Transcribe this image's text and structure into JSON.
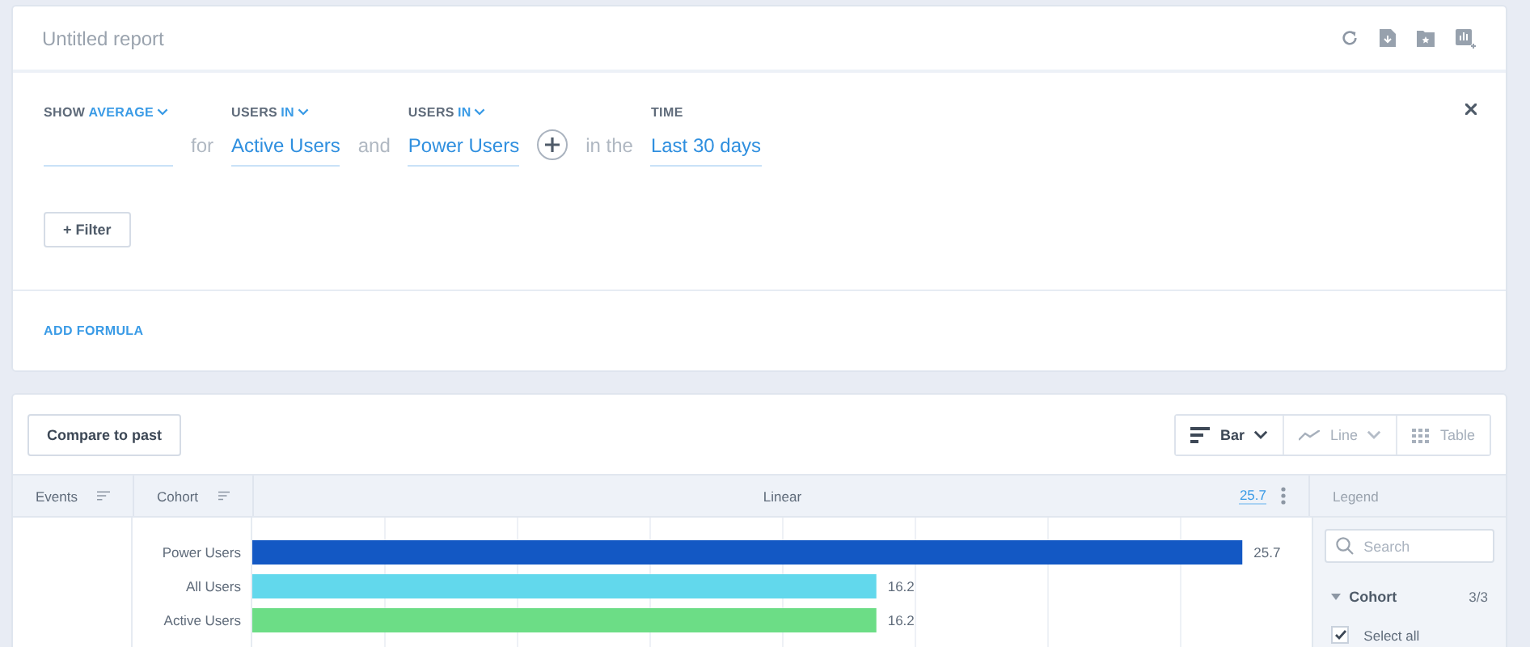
{
  "header": {
    "title": "Untitled report"
  },
  "query": {
    "segments": [
      {
        "kind": "metric",
        "label": "SHOW",
        "option": "AVERAGE"
      },
      {
        "kind": "word",
        "text": "for"
      },
      {
        "kind": "select",
        "label": "USERS",
        "option": "IN",
        "value": "Active Users"
      },
      {
        "kind": "word",
        "text": "and"
      },
      {
        "kind": "select",
        "label": "USERS",
        "option": "IN",
        "value": "Power Users"
      },
      {
        "kind": "add"
      },
      {
        "kind": "word",
        "text": "in the"
      },
      {
        "kind": "select",
        "label": "TIME",
        "value": "Last 30 days"
      }
    ],
    "filter_button": "+ Filter",
    "formula_link": "ADD FORMULA"
  },
  "toolbar": {
    "compare_button": "Compare to past",
    "views": [
      {
        "kind": "bar",
        "label": "Bar",
        "selected": true
      },
      {
        "kind": "line",
        "label": "Line",
        "selected": false
      },
      {
        "kind": "table",
        "label": "Table",
        "selected": false
      }
    ]
  },
  "table": {
    "columns": [
      "Events",
      "Cohort"
    ],
    "chart_heading": "Linear",
    "max_link": "25.7",
    "legend_heading": "Legend"
  },
  "chart_data": {
    "type": "bar",
    "orientation": "horizontal",
    "stacked": true,
    "categories": [
      "Power Users",
      "All Users",
      "Active Users"
    ],
    "series": [
      {
        "color": "#1358c4",
        "values": [
          25.7,
          null,
          null
        ]
      },
      {
        "color": "#62d8ec",
        "values": [
          null,
          16.2,
          null
        ]
      },
      {
        "color": "#6cdd86",
        "values": [
          null,
          null,
          16.2
        ]
      }
    ],
    "data_labels": true
  },
  "legend": {
    "search": {
      "placeholder": "Search"
    },
    "group": {
      "label": "Cohort",
      "count": "3/3",
      "expanded": true
    },
    "items": [
      {
        "label": "Select all",
        "checked": true
      }
    ]
  }
}
